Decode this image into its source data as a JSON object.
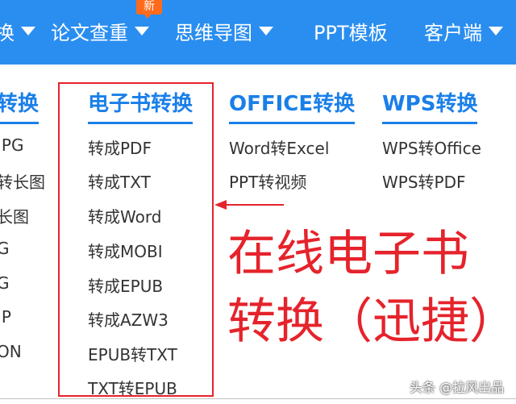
{
  "nav": {
    "items": [
      {
        "label": "换"
      },
      {
        "label": "论文查重"
      },
      {
        "label": "思维导图"
      },
      {
        "label": "PPT模板"
      },
      {
        "label": "客户端"
      }
    ],
    "new_badge": "新"
  },
  "columns": [
    {
      "title": "转换",
      "links": [
        "JPG",
        "转长图",
        "长图",
        "G",
        "G",
        "IP",
        "ON"
      ]
    },
    {
      "title": "电子书转换",
      "links": [
        "转成PDF",
        "转成TXT",
        "转成Word",
        "转成MOBI",
        "转成EPUB",
        "转成AZW3",
        "EPUB转TXT",
        "TXT转EPUB"
      ]
    },
    {
      "title": "OFFICE转换",
      "links": [
        "Word转Excel",
        "PPT转视频"
      ]
    },
    {
      "title": "WPS转换",
      "links": [
        "WPS转Office",
        "WPS转PDF"
      ]
    }
  ],
  "annotation": {
    "line1": "在线电子书",
    "line2": "转换（迅捷）"
  },
  "watermark": "头条 @拉风出品",
  "colors": {
    "nav_bg": "#2a8ef0",
    "accent": "#1a7fe8",
    "annotation": "#e5232b",
    "badge": "#ff6a1c"
  }
}
